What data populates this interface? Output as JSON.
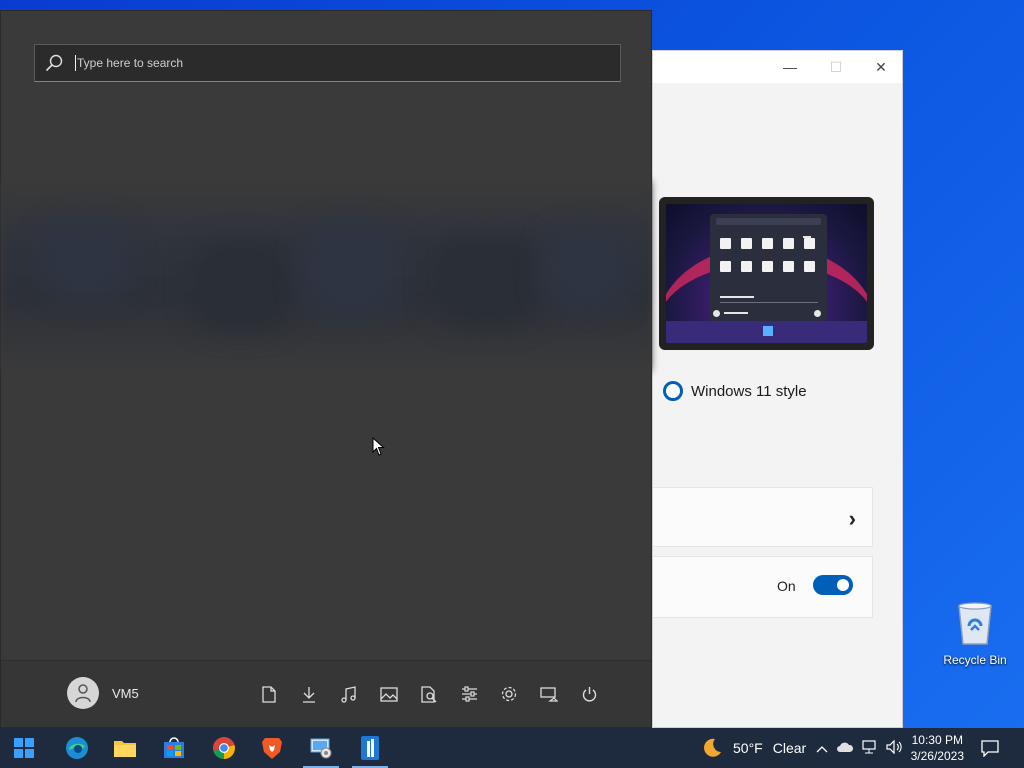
{
  "settings_window": {
    "option_label": "Windows 11 style",
    "toggle_label": "On",
    "accent_color": "#005fb8"
  },
  "start_menu": {
    "search": {
      "placeholder": "Type here to search",
      "value": ""
    },
    "user": {
      "name": "VM5"
    },
    "footer_icons": [
      "documents-icon",
      "downloads-icon",
      "music-icon",
      "pictures-icon",
      "file-explorer-icon",
      "personalization-icon",
      "settings-icon",
      "network-icon",
      "power-icon"
    ]
  },
  "desktop": {
    "recycle_bin_label": "Recycle Bin"
  },
  "taskbar": {
    "apps": [
      "start-button",
      "edge-icon",
      "file-explorer-icon",
      "store-icon",
      "chrome-icon",
      "brave-icon",
      "control-panel-icon",
      "app-icon"
    ],
    "weather": {
      "temperature": "50°F",
      "condition": "Clear"
    },
    "clock": {
      "time": "10:30 PM",
      "date": "3/26/2023"
    }
  }
}
